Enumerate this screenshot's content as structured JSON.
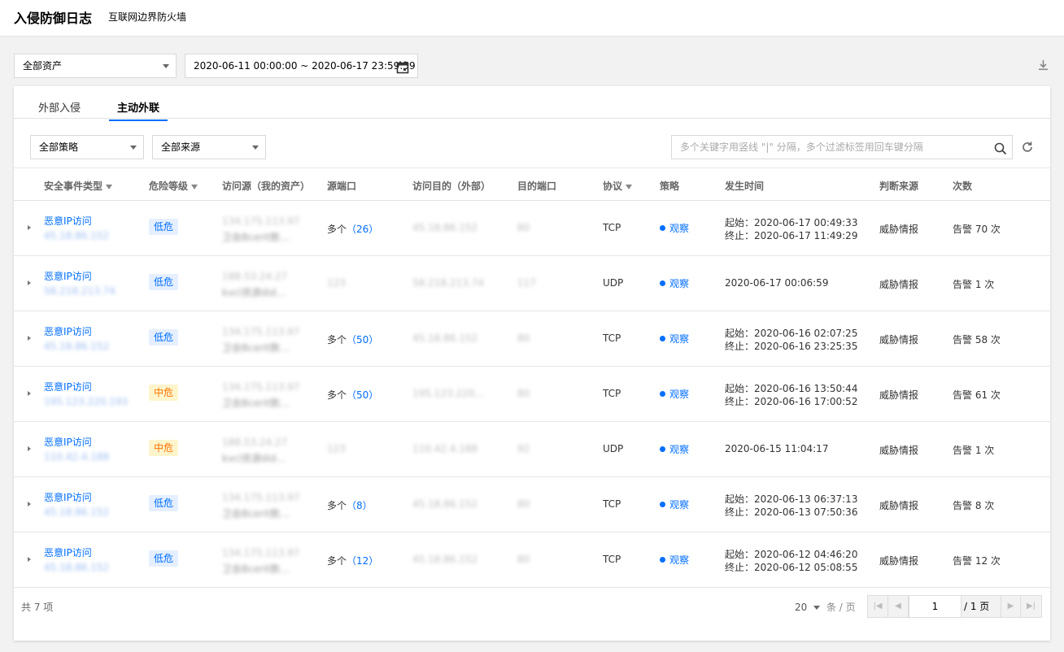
{
  "header": {
    "title": "入侵防御日志",
    "subtitle": "互联网边界防火墙"
  },
  "filters": {
    "asset": "全部资产",
    "date_range": "2020-06-11 00:00:00 ~ 2020-06-17 23:59:59"
  },
  "tabs": [
    {
      "label": "外部入侵"
    },
    {
      "label": "主动外联"
    }
  ],
  "toolbar": {
    "strategy": "全部策略",
    "source": "全部来源",
    "search_placeholder": "多个关键字用竖线 \"|\" 分隔，多个过滤标签用回车键分隔"
  },
  "columns": [
    "安全事件类型",
    "危险等级",
    "访问源（我的资产）",
    "源端口",
    "访问目的（外部）",
    "目的端口",
    "协议",
    "策略",
    "发生时间",
    "判断来源",
    "次数"
  ],
  "rows": [
    {
      "type": "恶意IP访问",
      "ip": "45.18.86.152",
      "level": "低危",
      "src": "134.175.113.97",
      "src2": "卫会Bcerit数…",
      "sport": "多个（26）",
      "dst": "45.18.86.152",
      "dport": "80",
      "proto": "TCP",
      "policy": "观察",
      "time1": "起始：2020-06-17 00:49:33",
      "time2": "终止：2020-06-17 11:49:29",
      "judge": "威胁情报",
      "count": "告警 70 次"
    },
    {
      "type": "恶意IP访问",
      "ip": "58.218.213.74",
      "level": "低危",
      "src": "188.53.24.27",
      "src2": "kvcl资源did…",
      "sport": "123",
      "dst": "58.218.213.74",
      "dport": "117",
      "proto": "UDP",
      "policy": "观察",
      "time1": "2020-06-17 00:06:59",
      "time2": "",
      "judge": "威胁情报",
      "count": "告警 1 次"
    },
    {
      "type": "恶意IP访问",
      "ip": "45.18.86.152",
      "level": "低危",
      "src": "134.175.113.97",
      "src2": "卫会Bcerit数…",
      "sport": "多个（50）",
      "dst": "45.18.86.152",
      "dport": "80",
      "proto": "TCP",
      "policy": "观察",
      "time1": "起始：2020-06-16 02:07:25",
      "time2": "终止：2020-06-16 23:25:35",
      "judge": "威胁情报",
      "count": "告警 58 次"
    },
    {
      "type": "恶意IP访问",
      "ip": "195.123.220.193",
      "level": "中危",
      "src": "134.175.113.97",
      "src2": "卫会Bcerit数…",
      "sport": "多个（50）",
      "dst": "195.123.220…",
      "dport": "80",
      "proto": "TCP",
      "policy": "观察",
      "time1": "起始：2020-06-16 13:50:44",
      "time2": "终止：2020-06-16 17:00:52",
      "judge": "威胁情报",
      "count": "告警 61 次"
    },
    {
      "type": "恶意IP访问",
      "ip": "110.42.4.188",
      "level": "中危",
      "src": "188.53.24.27",
      "src2": "kvcl资源did…",
      "sport": "123",
      "dst": "110.42.4.188",
      "dport": "92",
      "proto": "UDP",
      "policy": "观察",
      "time1": "2020-06-15 11:04:17",
      "time2": "",
      "judge": "威胁情报",
      "count": "告警 1 次"
    },
    {
      "type": "恶意IP访问",
      "ip": "45.18.86.152",
      "level": "低危",
      "src": "134.175.113.97",
      "src2": "卫会Bcerit数…",
      "sport": "多个（8）",
      "dst": "45.18.86.152",
      "dport": "80",
      "proto": "TCP",
      "policy": "观察",
      "time1": "起始：2020-06-13 06:37:13",
      "time2": "终止：2020-06-13 07:50:36",
      "judge": "威胁情报",
      "count": "告警 8 次"
    },
    {
      "type": "恶意IP访问",
      "ip": "45.18.86.152",
      "level": "低危",
      "src": "134.175.113.97",
      "src2": "卫会Bcerit数…",
      "sport": "多个（12）",
      "dst": "45.18.86.152",
      "dport": "80",
      "proto": "TCP",
      "policy": "观察",
      "time1": "起始：2020-06-12 04:46:20",
      "time2": "终止：2020-06-12 05:08:55",
      "judge": "威胁情报",
      "count": "告警 12 次"
    }
  ],
  "footer": {
    "total": "共 7 项",
    "page_size": "20",
    "page_size_unit": "条 / 页",
    "current_page": "1",
    "total_pages": "/ 1 页"
  }
}
